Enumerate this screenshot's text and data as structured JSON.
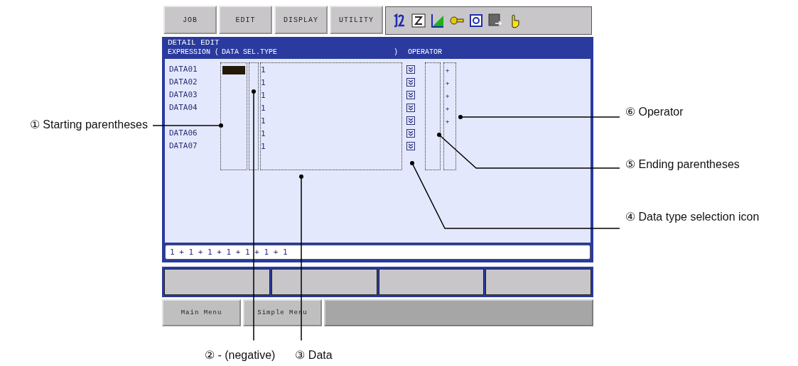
{
  "menu_tabs": [
    "JOB",
    "EDIT",
    "DISPLAY",
    "UTILITY"
  ],
  "screen": {
    "title": "DETAIL EDIT",
    "header_columns": [
      "EXPRESSION",
      "(",
      "DATA",
      "SEL.TYPE",
      ")",
      "OPERATOR"
    ],
    "rows": [
      {
        "label": "DATA01",
        "data": "1",
        "operator": "+",
        "selected": true
      },
      {
        "label": "DATA02",
        "data": "1",
        "operator": "+",
        "selected": false
      },
      {
        "label": "DATA03",
        "data": "1",
        "operator": "+",
        "selected": false
      },
      {
        "label": "DATA04",
        "data": "1",
        "operator": "+",
        "selected": false
      },
      {
        "data": "1",
        "operator": "+",
        "selected": false
      },
      {
        "label": "DATA06",
        "data": "1",
        "selected": false
      },
      {
        "label": "DATA07",
        "data": "1",
        "selected": false
      }
    ],
    "expression": "1 + 1 + 1 + 1 + 1 + 1 + 1"
  },
  "bottom_buttons": [
    "Main Menu",
    "Simple Menu"
  ],
  "left_callouts": [
    {
      "number": "①",
      "text": "Starting parentheses"
    }
  ],
  "right_callouts": [
    {
      "number": "⑥",
      "text": "Operator"
    },
    {
      "number": "⑤",
      "text": "Ending parentheses"
    },
    {
      "number": "④",
      "text": "Data type selection icon"
    }
  ],
  "bottom_callouts": [
    {
      "number": "②",
      "text": "- (negative)"
    },
    {
      "number": "③",
      "text": "Data"
    }
  ]
}
